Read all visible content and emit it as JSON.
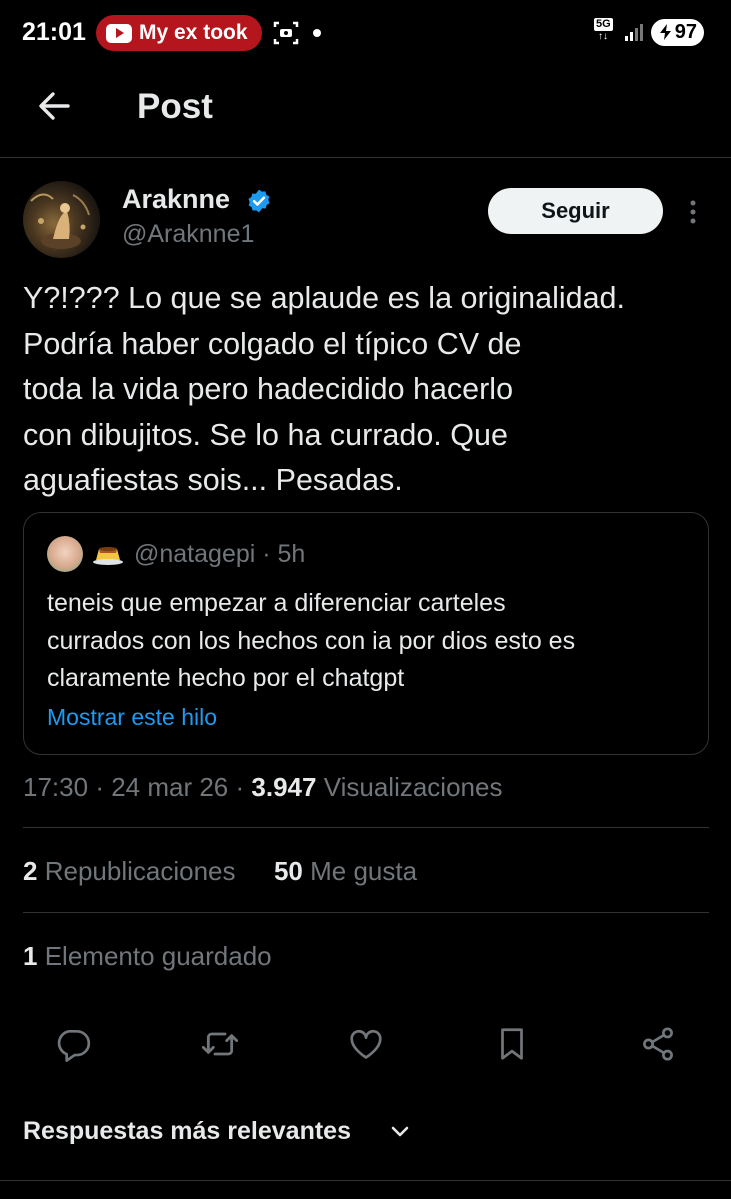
{
  "status_bar": {
    "time": "21:01",
    "media_title": "My ex took",
    "network": "5G",
    "network_arrows": "↑↓",
    "battery": "97"
  },
  "header": {
    "title": "Post",
    "back_icon": "arrow-left-icon"
  },
  "post": {
    "author_name": "Araknne",
    "author_handle": "@Araknne1",
    "verified": true,
    "follow_label": "Seguir",
    "text_lines": [
      "Y?!??? Lo que se aplaude es la originalidad.",
      "Podría haber colgado el típico CV de",
      "toda la vida pero hadecidido hacerlo",
      "con dibujitos. Se lo ha currado. Que",
      "aguafiestas sois... Pesadas."
    ],
    "quote": {
      "handle": "@natagepi",
      "time": "5h",
      "handle_time": "@natagepi · 5h",
      "emoji": "🍮",
      "text_lines": [
        "teneis que empezar a diferenciar carteles",
        "currados con los hechos con ia por dios esto es",
        "claramente hecho por el chatgpt"
      ],
      "link": "Mostrar este hilo"
    },
    "meta": {
      "time": "17:30",
      "date": "24 mar 26",
      "views": "3.947",
      "views_label": "Visualizaciones"
    },
    "stats": {
      "reposts": "2",
      "reposts_label": "Republicaciones",
      "likes": "50",
      "likes_label": "Me gusta",
      "bookmarks": "1",
      "bookmarks_label": "Elemento guardado"
    }
  },
  "actions": [
    "reply-icon",
    "repost-icon",
    "like-icon",
    "bookmark-icon",
    "share-icon"
  ],
  "replies": {
    "sort_label": "Respuestas más relevantes"
  },
  "colors": {
    "background": "#000000",
    "text": "#e7e9ea",
    "muted": "#71767b",
    "accent": "#1d9bf0",
    "divider": "#2f3336",
    "media_pill": "#b5161d"
  }
}
